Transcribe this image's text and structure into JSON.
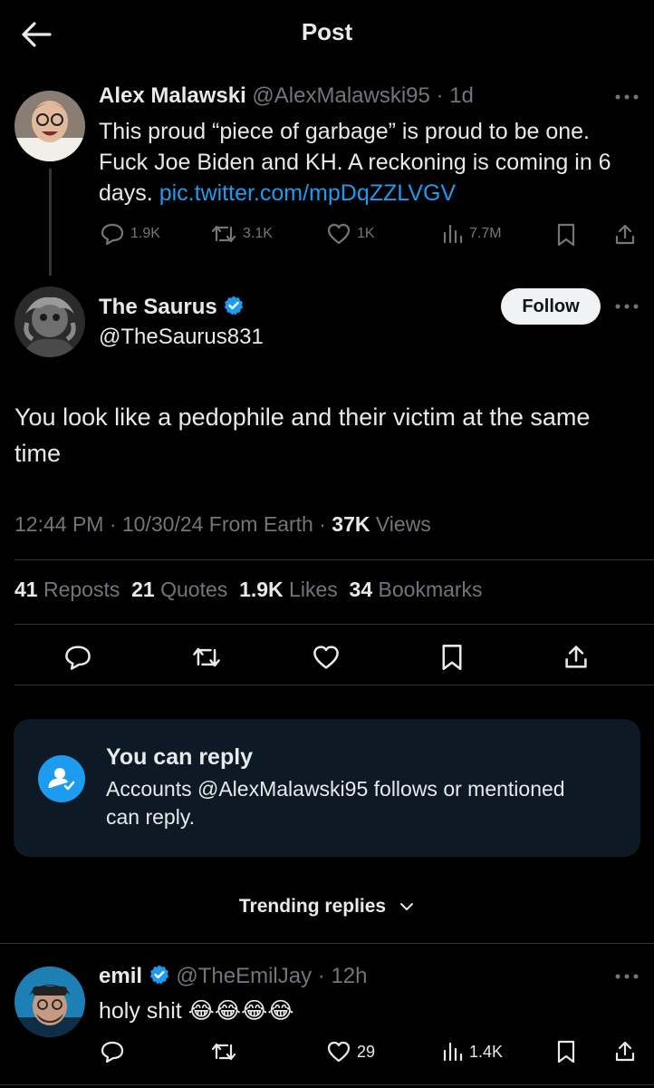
{
  "header": {
    "title": "Post",
    "back_icon": "arrow-left-icon"
  },
  "parent_tweet": {
    "name": "Alex Malawski",
    "handle": "@AlexMalawski95",
    "time": "· 1d",
    "text": "This proud “piece of garbage” is proud to be one. Fuck Joe Biden and KH. A reckoning is coming in 6 days.",
    "link": "pic.twitter.com/mpDqZZLVGV",
    "replies": "1.9K",
    "reposts": "3.1K",
    "likes": "1K",
    "views": "7.7M"
  },
  "main_tweet": {
    "name": "The Saurus",
    "handle": "@TheSaurus831",
    "follow_label": "Follow",
    "text": "You look like a pedophile and their victim at the same time",
    "meta_prefix": "12:44 PM · 10/30/24 From Earth · ",
    "views_count": "37K",
    "views_label": " Views",
    "stats": [
      {
        "count": "41",
        "label": "Reposts"
      },
      {
        "count": "21",
        "label": "Quotes"
      },
      {
        "count": "1.9K",
        "label": "Likes"
      },
      {
        "count": "34",
        "label": "Bookmarks"
      }
    ]
  },
  "reply_notice": {
    "title": "You can reply",
    "body": "Accounts @AlexMalawski95 follows or mentioned can reply."
  },
  "trending": {
    "label": "Trending replies"
  },
  "reply": {
    "name": "emil",
    "handle": "@TheEmilJay",
    "time": "· 12h",
    "text": "holy shit 😂😂😂😂",
    "likes": "29",
    "views": "1.4K"
  },
  "colors": {
    "accent": "#1d9bf0",
    "background": "#000000",
    "text": "#e7e9ea",
    "muted": "#71767b",
    "card": "#0d1a26"
  }
}
